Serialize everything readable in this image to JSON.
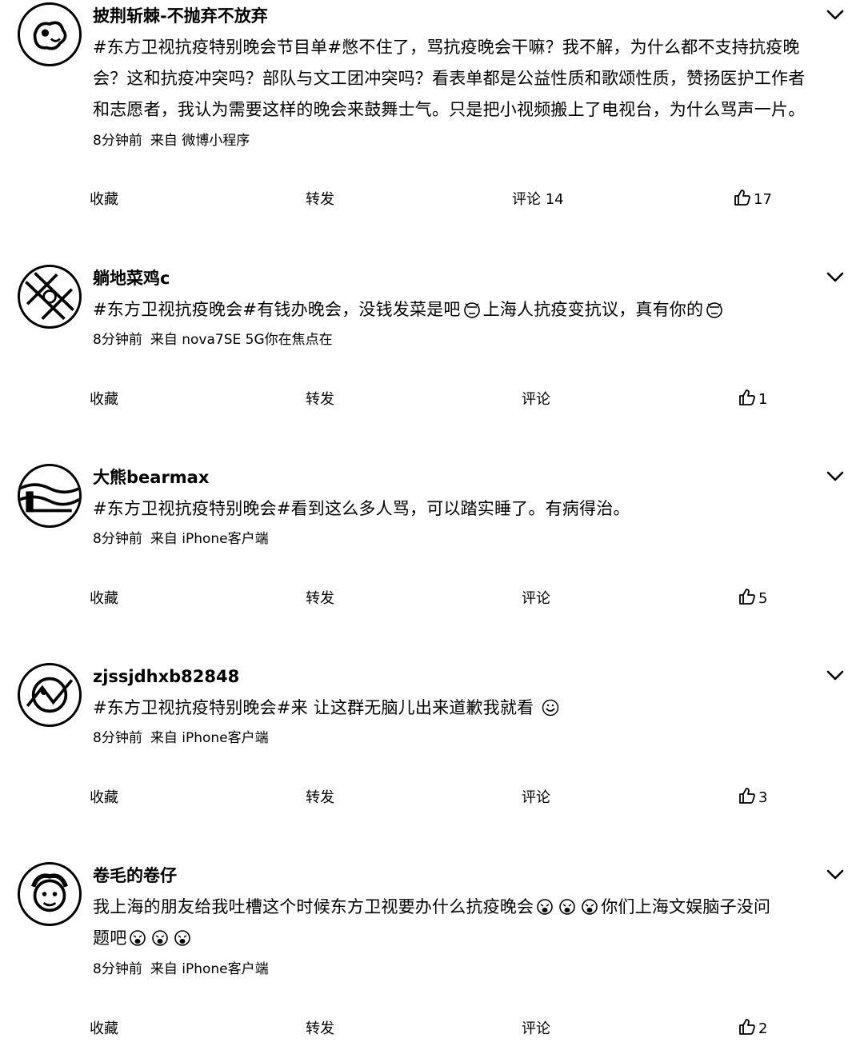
{
  "actions": {
    "favorite": "收藏",
    "forward": "转发",
    "comment": "评论"
  },
  "posts": [
    {
      "username": "披荆斩棘-不抛弃不放弃",
      "text": [
        "#东方卫视抗疫特别晚会节目单#憋不住了，骂抗疫晚会干嘛？我不解，为什么都不支持抗疫晚",
        "会？这和抗疫冲突吗？部队与文工团冲突吗？看表单都是公益性质和歌颂性质，赞扬医护工作者",
        "和志愿者，我认为需要这样的晚会来鼓舞士气。只是把小视频搬上了电视台，为什么骂声一片。"
      ],
      "time": "8分钟前",
      "source": "来自 微博小程序",
      "comments": "14",
      "likes": "17"
    },
    {
      "username": "躺地菜鸡c",
      "text_parts": [
        "#东方卫视抗疫晚会#有钱办晚会，没钱发菜是吧",
        "上海人抗疫变抗议，真有你的"
      ],
      "emoji": "angry-face",
      "time": "8分钟前",
      "source": "来自 nova7SE 5G你在焦点在",
      "comments": "",
      "likes": "1"
    },
    {
      "username": "大熊bearmax",
      "text": "#东方卫视抗疫特别晚会#看到这么多人骂，可以踏实睡了。有病得治。",
      "time": "8分钟前",
      "source": "来自 iPhone客户端",
      "comments": "",
      "likes": "5"
    },
    {
      "username": "zjssjdhxb82848",
      "text": "#东方卫视抗疫特别晚会#来 让这群无脑儿出来道歉我就看",
      "emoji": "smile-face",
      "time": "8分钟前",
      "source": "来自 iPhone客户端",
      "comments": "",
      "likes": "3"
    },
    {
      "username": "卷毛的卷仔",
      "text_parts": [
        "我上海的朋友给我吐槽这个时候东方卫视要办什么抗疫晚会",
        "你们上海文娱脑子没问",
        "题吧"
      ],
      "emoji": "vomit-face",
      "time": "8分钟前",
      "source": "来自 iPhone客户端",
      "comments": "",
      "likes": "2"
    }
  ]
}
